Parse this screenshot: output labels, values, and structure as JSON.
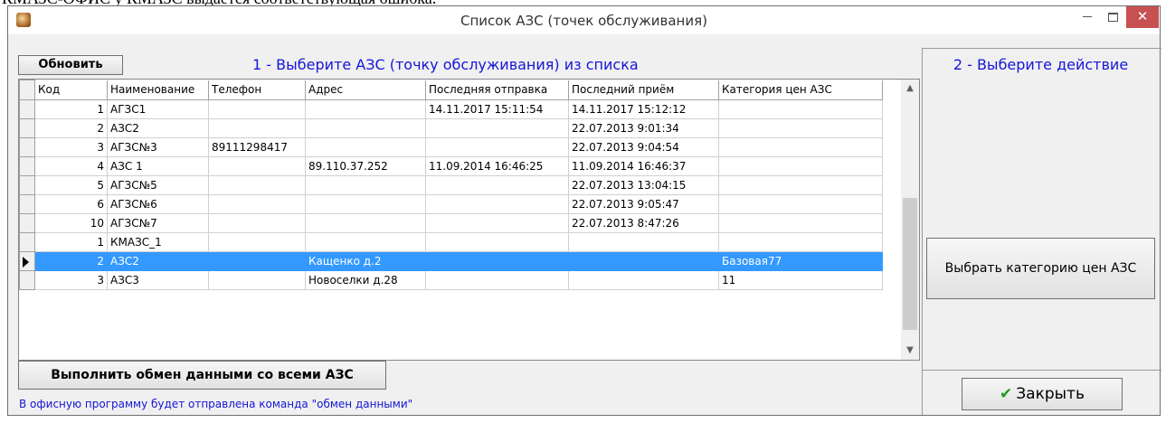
{
  "document": {
    "top_text": "КМАЗС-ОФИС у КМАЗС выдается соответствующая ошибка."
  },
  "window": {
    "title": "Список АЗС (точек обслуживания)"
  },
  "toolbar": {
    "refresh_label": "Обновить",
    "step1_label": "1 - Выберите АЗС (точку обслуживания) из списка",
    "step2_label": "2 - Выберите действие"
  },
  "table": {
    "columns": [
      "Код",
      "Наименование",
      "Телефон",
      "Адрес",
      "Последняя отправка",
      "Последний приём",
      "Категория цен АЗС"
    ],
    "rows": [
      [
        "1",
        "АГЗС1",
        "",
        "",
        "14.11.2017 15:11:54",
        "14.11.2017 15:12:12",
        ""
      ],
      [
        "2",
        "АЗС2",
        "",
        "",
        "",
        "22.07.2013 9:01:34",
        ""
      ],
      [
        "3",
        "АГЗС№3",
        "89111298417",
        "",
        "",
        "22.07.2013 9:04:54",
        ""
      ],
      [
        "4",
        "АЗС 1",
        "",
        "89.110.37.252",
        "11.09.2014 16:46:25",
        "11.09.2014 16:46:37",
        ""
      ],
      [
        "5",
        "АГЗС№5",
        "",
        "",
        "",
        "22.07.2013 13:04:15",
        ""
      ],
      [
        "6",
        "АГЗС№6",
        "",
        "",
        "",
        "22.07.2013 9:05:47",
        ""
      ],
      [
        "10",
        "АГЗС№7",
        "",
        "",
        "",
        "22.07.2013 8:47:26",
        ""
      ],
      [
        "1",
        "КМАЗС_1",
        "",
        "",
        "",
        "",
        ""
      ],
      [
        "2",
        "АЗС2",
        "",
        "Кащенко д.2",
        "",
        "",
        "Базовая77"
      ],
      [
        "3",
        "АЗС3",
        "",
        "Новоселки д.28",
        "",
        "",
        "11"
      ]
    ],
    "selected_row": 9
  },
  "actions": {
    "category_label": "Выбрать категорию цен АЗС",
    "exchange_label": "Выполнить обмен данными со всеми АЗС",
    "info_text": "В офисную программу будет отправлена команда \"обмен данными\"",
    "close_label": "Закрыть"
  },
  "colors": {
    "accent_text": "#1515d8",
    "selection": "#3399ff",
    "close_button": "#c75050",
    "check_icon": "#1e9a1e"
  }
}
